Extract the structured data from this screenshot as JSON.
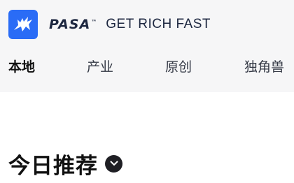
{
  "brand": {
    "wordmark": "PASA",
    "trademark": "™",
    "slogan": "GET RICH FAST",
    "accent_color": "#2a6cf6",
    "logo_icon": "bull-icon"
  },
  "nav": {
    "items": [
      {
        "label": "本地",
        "active": true
      },
      {
        "label": "产业",
        "active": false
      },
      {
        "label": "原创",
        "active": false
      },
      {
        "label": "独角兽",
        "active": false
      }
    ]
  },
  "section": {
    "title": "今日推荐",
    "toggle_icon": "chevron-down-icon"
  }
}
